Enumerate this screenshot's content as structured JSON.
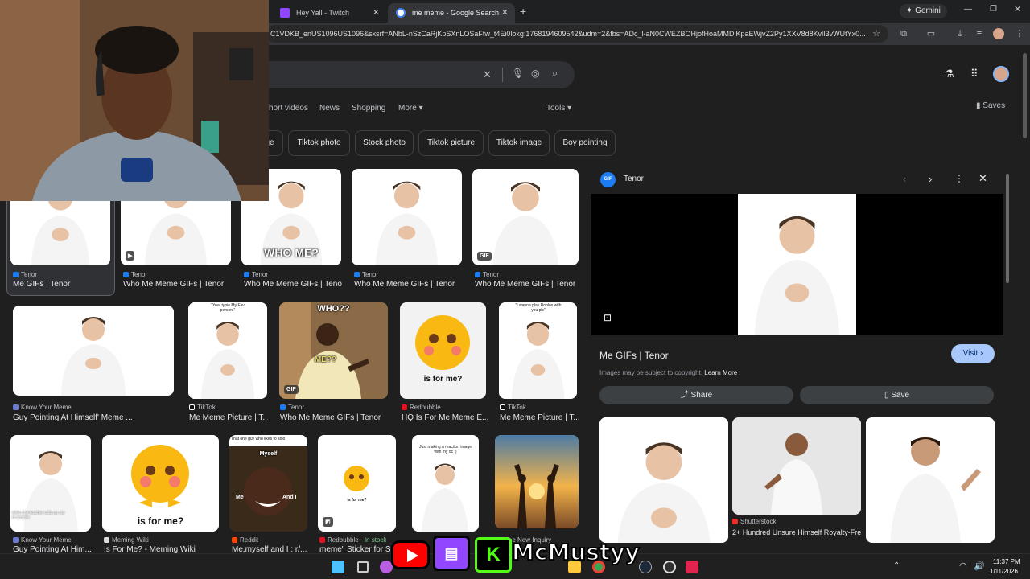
{
  "tabs": [
    {
      "title": "Hey Yall - Twitch",
      "icon": "twitch-icon",
      "color": "#9146ff",
      "active": false
    },
    {
      "title": "me meme - Google Search",
      "icon": "google-icon",
      "color": "#ffffff",
      "active": true
    }
  ],
  "window": {
    "gemini_label": "Gemini"
  },
  "omnibox": {
    "url": "C1VDKB_enUS1096US1096&sxsrf=ANbL-nSzCaRjKpSXnLOSaFtw_t4Ei0lokg:1768194609542&udm=2&fbs=ADc_l-aN0CWEZBOHjofHoaMMDiKpaEWjvZ2Py1XXV8d8KvlI3vWUtYx0..."
  },
  "nav": {
    "short_videos": "hort videos",
    "news": "News",
    "shopping": "Shopping",
    "more": "More",
    "tools": "Tools",
    "saves": "Saves"
  },
  "chips": [
    "ge",
    "Tiktok photo",
    "Stock photo",
    "Tiktok picture",
    "Tiktok image",
    "Boy pointing"
  ],
  "row1": [
    {
      "source": "Tenor",
      "title": "Me GIFs | Tenor",
      "badge": ""
    },
    {
      "source": "Tenor",
      "title": "Who Me Meme GIFs | Tenor",
      "badge": "play"
    },
    {
      "source": "Tenor",
      "title": "Who Me Meme GIFs | Tenor",
      "badge": "",
      "overlay": "WHO ME?"
    },
    {
      "source": "Tenor",
      "title": "Who Me Meme GIFs | Tenor",
      "badge": ""
    },
    {
      "source": "Tenor",
      "title": "Who Me Meme GIFs | Tenor",
      "badge": "GIF"
    }
  ],
  "row2": [
    {
      "source": "Know Your Meme",
      "title": "Guy Pointing At Himself' Meme ..."
    },
    {
      "source": "TikTok",
      "title": "Me Meme Picture | T...",
      "caption": "\"Your typie My Fav person.\""
    },
    {
      "source": "Tenor",
      "title": "Who Me Meme GIFs | Tenor",
      "badge": "GIF",
      "overlay_top": "WHO??",
      "overlay_mid": "ME??"
    },
    {
      "source": "Redbubble",
      "title": "HQ Is For Me Meme E...",
      "caption": "is for me?"
    },
    {
      "source": "TikTok",
      "title": "Me Meme Picture | T...",
      "caption": "\"I wanna play Roblox with you pls\""
    }
  ],
  "row3": [
    {
      "source": "Know Your Meme",
      "title": "Guy Pointing At Him...",
      "caption": "when the teacher calls on me to answer"
    },
    {
      "source": "Meming Wiki",
      "title": "Is For Me? - Meming Wiki",
      "caption": "is for me?"
    },
    {
      "source": "Reddit",
      "title": "Me,myself and I : r/...",
      "caption_top": "That one guy who likes to solo",
      "caption_a": "Myself",
      "caption_b": "Me",
      "caption_c": "And I"
    },
    {
      "source": "Redbubble",
      "in_stock": "In stock",
      "title": "meme\" Sticker for S",
      "caption": "is for me?"
    },
    {
      "source": "",
      "title": "",
      "caption": "Just making a reaction image with my oc :)"
    },
    {
      "source": "The New Inquiry",
      "title": ""
    }
  ],
  "panel": {
    "source": "Tenor",
    "title": "Me GIFs | Tenor",
    "visit": "Visit",
    "copyright": "Images may be subject to copyright.",
    "learn_more": "Learn More",
    "share": "Share",
    "save": "Save",
    "related": [
      {
        "source": "",
        "title": ""
      },
      {
        "source": "Shutterstock",
        "title": "2+ Hundred Unsure Himself Royalty-Fre..."
      },
      {
        "source": "",
        "title": ""
      }
    ]
  },
  "overlay_brand": {
    "name": "McMustyy"
  },
  "taskbar": {
    "time": "11:37 PM",
    "date": "1/11/2026"
  },
  "colors": {
    "accent_visit": "#a8c7fa",
    "twitch": "#9146ff",
    "youtube": "#ff0000",
    "kick": "#53fc18"
  }
}
